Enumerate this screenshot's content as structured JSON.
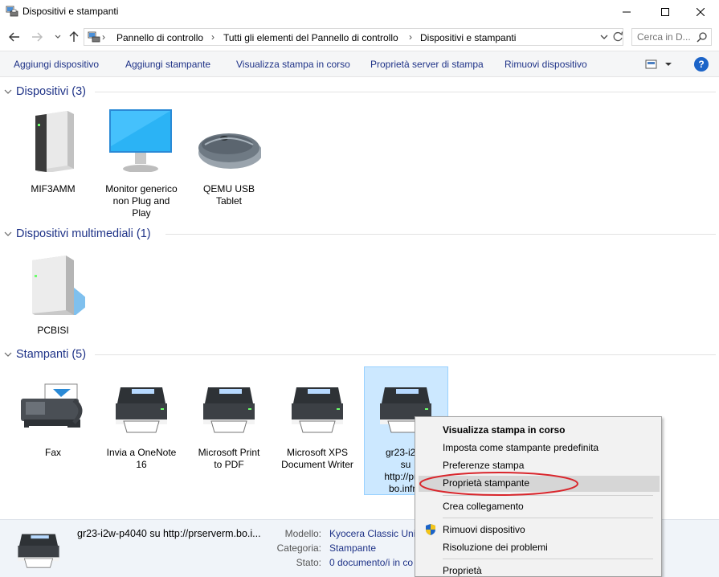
{
  "window": {
    "title": "Dispositivi e stampanti"
  },
  "address": {
    "crumbs": [
      "Pannello di controllo",
      "Tutti gli elementi del Pannello di controllo",
      "Dispositivi e stampanti"
    ],
    "search_placeholder": "Cerca in D..."
  },
  "toolbar": {
    "commands": [
      "Aggiungi dispositivo",
      "Aggiungi stampante",
      "Visualizza stampa in corso",
      "Proprietà server di stampa",
      "Rimuovi dispositivo"
    ],
    "help_label": "?"
  },
  "groups": {
    "devices": {
      "title": "Dispositivi (3)",
      "items": [
        "MIF3AMM",
        "Monitor generico\nnon Plug and\nPlay",
        "QEMU USB\nTablet"
      ]
    },
    "multimedia": {
      "title": "Dispositivi multimediali (1)",
      "items": [
        "PCBISI"
      ]
    },
    "printers": {
      "title": "Stampanti (5)",
      "items": [
        "Fax",
        "Invia a OneNote\n16",
        "Microsoft Print\nto PDF",
        "Microsoft XPS\nDocument Writer",
        "gr23-i2w-\nsu\nhttp://prse\nbo.infn.i"
      ]
    }
  },
  "details": {
    "name": "gr23-i2w-p4040 su http://prserverm.bo.i...",
    "model_label": "Modello:",
    "model_value": "Kyocera Classic Univ",
    "category_label": "Categoria:",
    "category_value": "Stampante",
    "status_label": "Stato:",
    "status_value": "0 documento/i in co"
  },
  "context_menu": {
    "items": [
      "Visualizza stampa in corso",
      "Imposta come stampante predefinita",
      "Preferenze stampa",
      "Proprietà stampante",
      "Crea collegamento",
      "Rimuovi dispositivo",
      "Risoluzione dei problemi",
      "Proprietà"
    ]
  },
  "colors": {
    "accent_text": "#1e3287",
    "selection": "#cce8ff",
    "annotation": "#d9262c"
  }
}
